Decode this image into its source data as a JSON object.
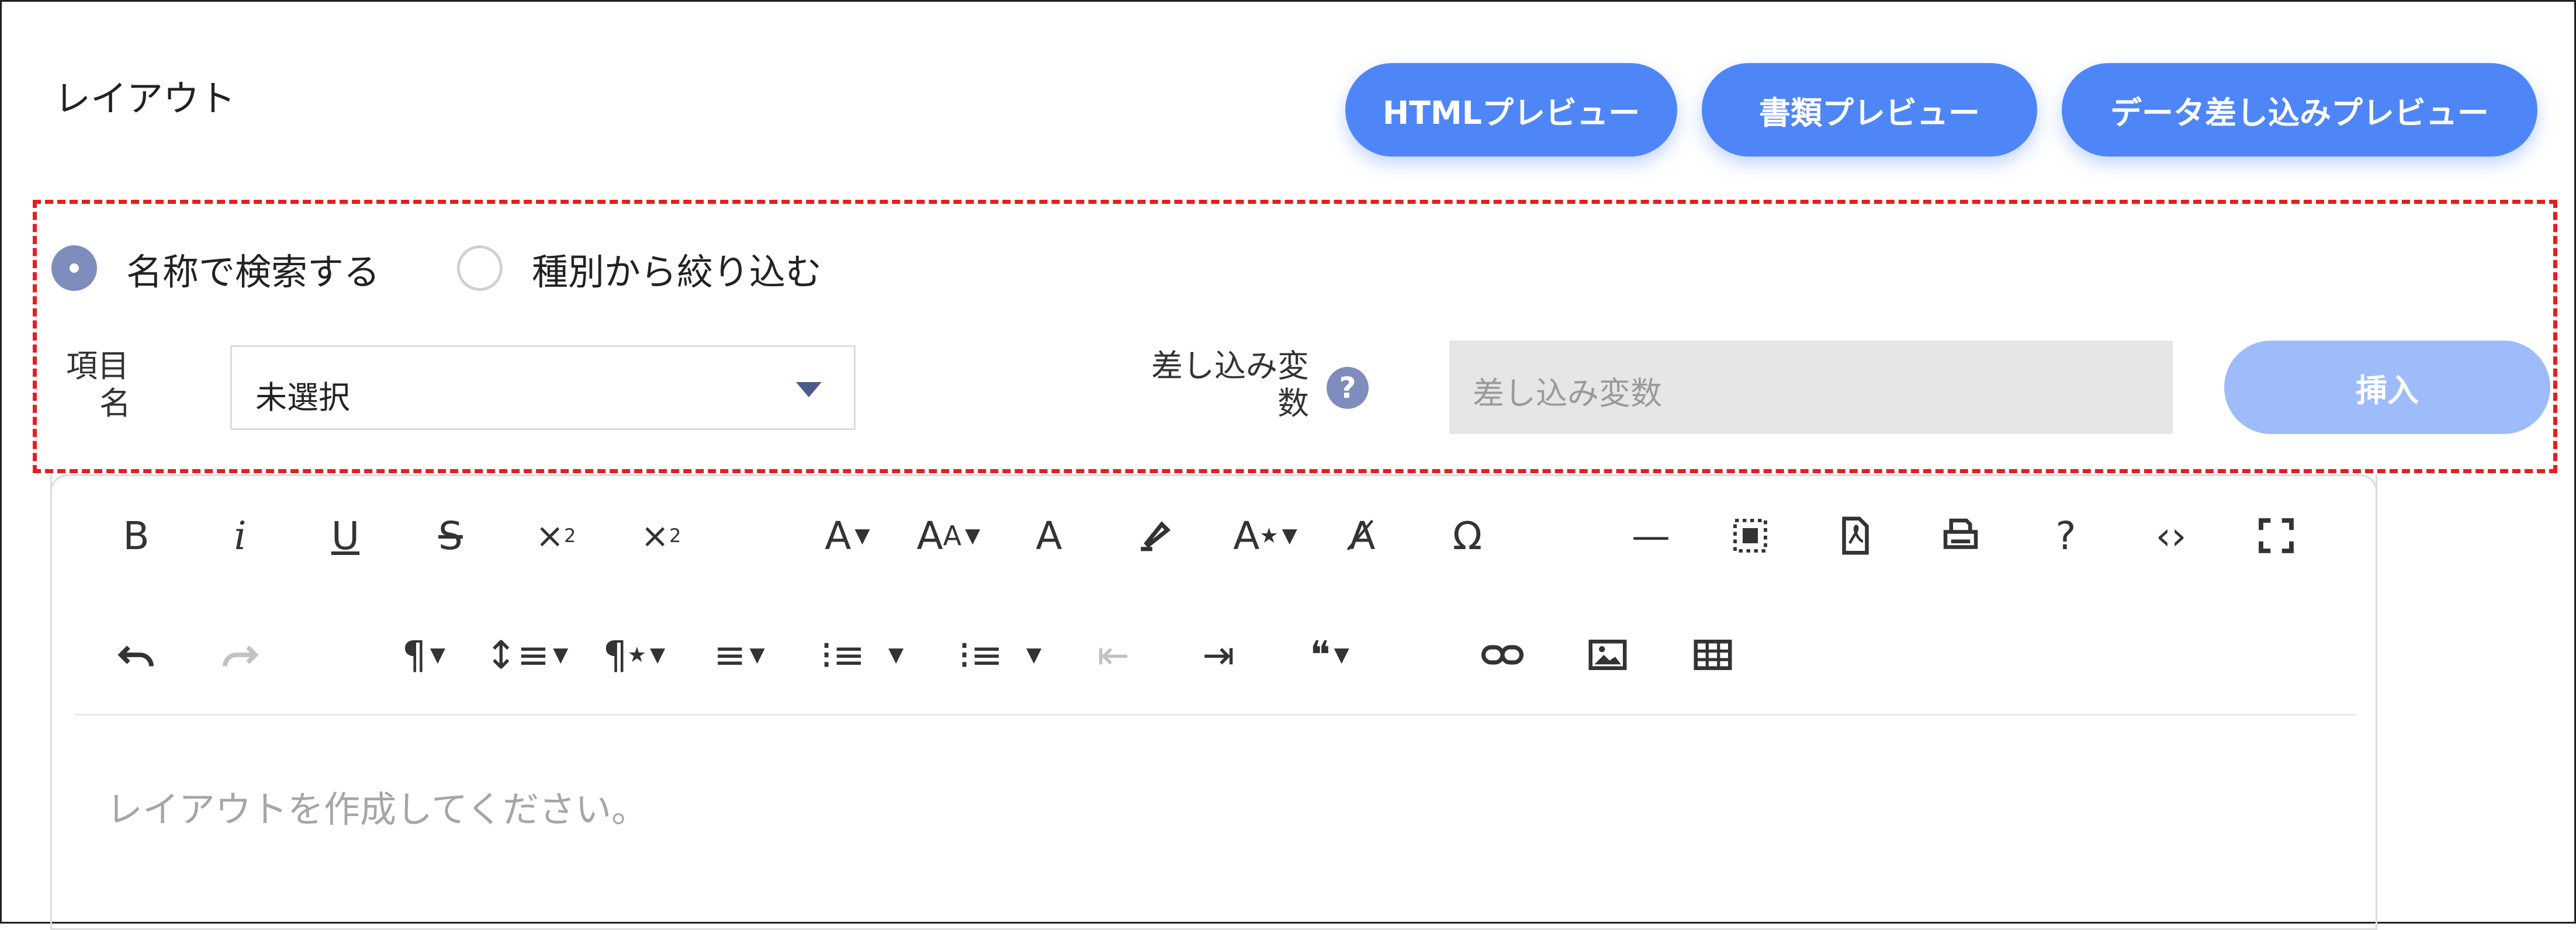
{
  "header": {
    "title": "レイアウト",
    "buttons": {
      "html_preview": "HTMLプレビュー",
      "doc_preview": "書類プレビュー",
      "merge_preview": "データ差し込みプレビュー"
    }
  },
  "search": {
    "mode_options": [
      "名称で検索する",
      "種別から絞り込む"
    ],
    "selected_mode": "名称で検索する",
    "item_label_line1": "項目",
    "item_label_line2": "名",
    "item_value": "未選択",
    "var_label_line1": "差し込み変",
    "var_label_line2": "数",
    "help_symbol": "?",
    "var_placeholder": "差し込み変数",
    "insert_label": "挿入"
  },
  "editor": {
    "placeholder": "レイアウトを作成してください。",
    "toolbar_row1": [
      "bold",
      "italic",
      "underline",
      "strikethrough",
      "subscript",
      "superscript",
      "font-family",
      "font-size",
      "text-color",
      "background-color",
      "inline-style",
      "clear-formatting",
      "special-characters",
      "horizontal-line",
      "select-all",
      "export-pdf",
      "print",
      "help",
      "code-view",
      "fullscreen"
    ],
    "toolbar_row2": [
      "undo",
      "redo",
      "paragraph-format",
      "line-height",
      "paragraph-style",
      "align",
      "ordered-list",
      "unordered-list",
      "outdent",
      "indent",
      "quote",
      "insert-link",
      "insert-image",
      "insert-table"
    ]
  },
  "colors": {
    "primary": "#4f86f7",
    "primary_disabled": "#9dbcf9",
    "radio_selected": "#7f8dbd",
    "highlight_border": "#e61e1e",
    "input_disabled_bg": "#e6e6e6"
  }
}
